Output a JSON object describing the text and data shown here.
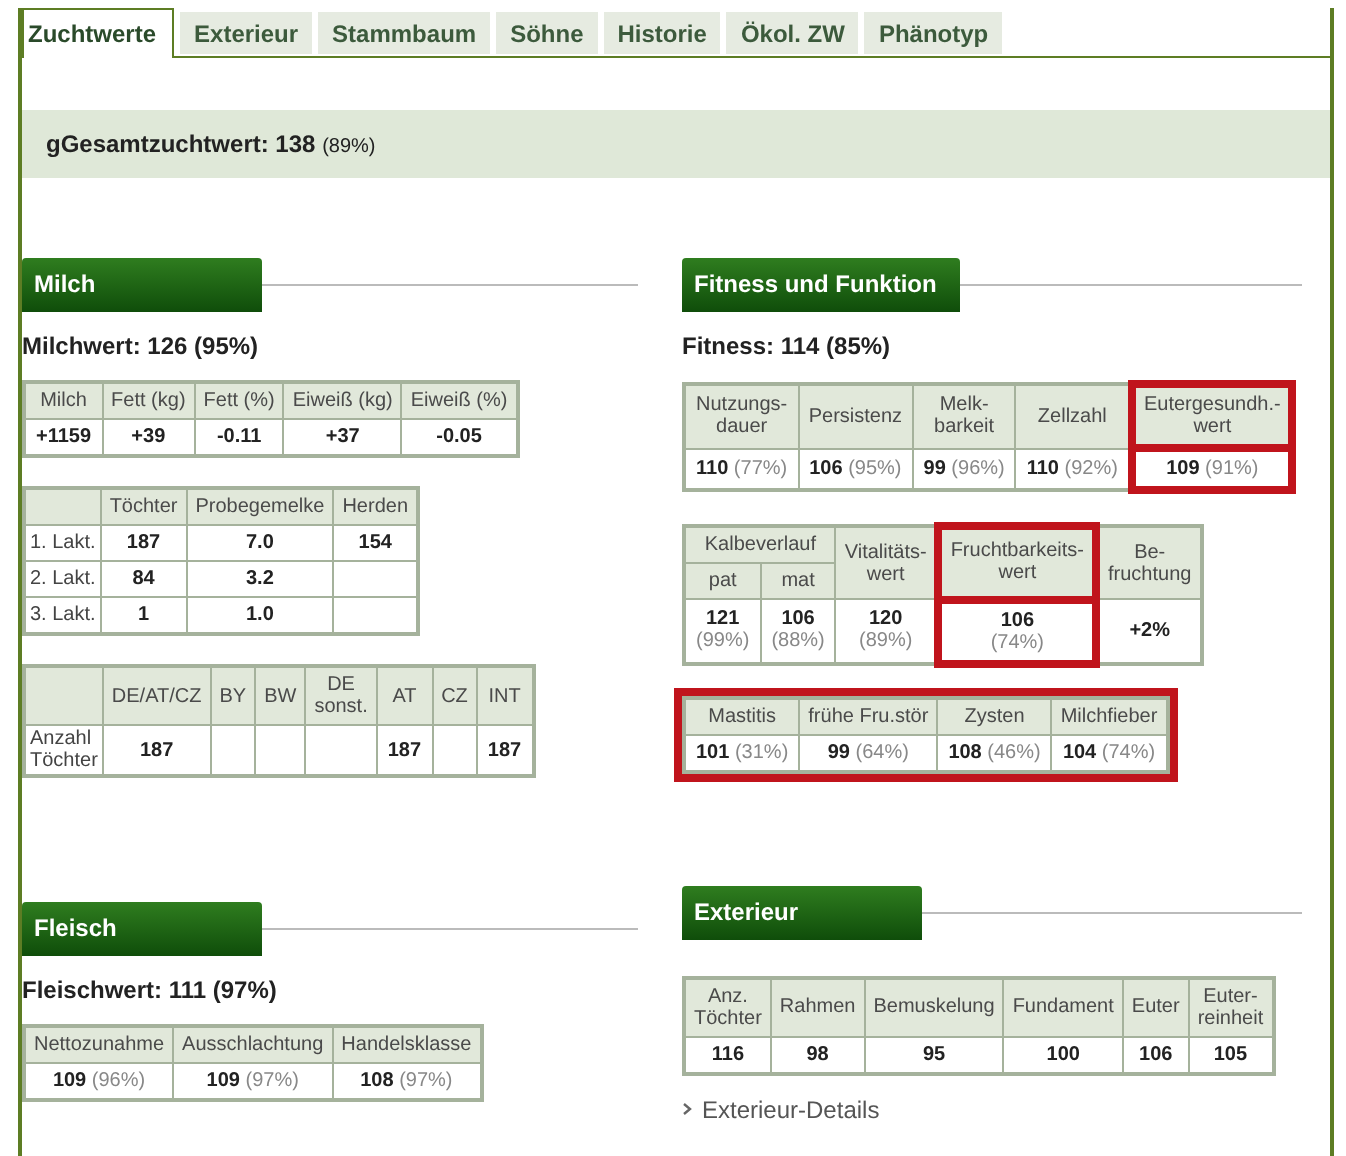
{
  "tabs": [
    {
      "label": "Zuchtwerte",
      "selected": true
    },
    {
      "label": "Exterieur",
      "selected": false
    },
    {
      "label": "Stammbaum",
      "selected": false
    },
    {
      "label": "Söhne",
      "selected": false
    },
    {
      "label": "Historie",
      "selected": false
    },
    {
      "label": "Ökol. ZW",
      "selected": false
    },
    {
      "label": "Phänotyp",
      "selected": false
    }
  ],
  "summary": {
    "label": "gGesamtzuchtwert: 138",
    "share": "(89%)"
  },
  "left_column": [
    {
      "title": "Milch",
      "score": "Milchwert: 126 (95%)",
      "tables": [
        {
          "highlighted": false,
          "rows": [
            [
              {
                "kind": "head",
                "text": "Milch"
              },
              {
                "kind": "head",
                "text": "Fett (kg)"
              },
              {
                "kind": "head",
                "text": "Fett (%)"
              },
              {
                "kind": "head",
                "text": "Eiweiß (kg)"
              },
              {
                "kind": "head",
                "text": "Eiweiß (%)"
              }
            ],
            [
              {
                "kind": "value",
                "text": "+1159"
              },
              {
                "kind": "value",
                "text": "+39"
              },
              {
                "kind": "value",
                "text": "-0.11"
              },
              {
                "kind": "value",
                "text": "+37"
              },
              {
                "kind": "value",
                "text": "-0.05"
              }
            ]
          ]
        },
        {
          "highlighted": false,
          "rows": [
            [
              {
                "kind": "blank"
              },
              {
                "kind": "head",
                "text": "Töchter"
              },
              {
                "kind": "head",
                "text": "Probegemelke"
              },
              {
                "kind": "head",
                "text": "Herden"
              }
            ],
            [
              {
                "kind": "label",
                "text": "1. Lakt."
              },
              {
                "kind": "value",
                "text": "187"
              },
              {
                "kind": "value",
                "text": "7.0"
              },
              {
                "kind": "value",
                "text": "154"
              }
            ],
            [
              {
                "kind": "label",
                "text": "2. Lakt."
              },
              {
                "kind": "value",
                "text": "84"
              },
              {
                "kind": "value",
                "text": "3.2"
              },
              {
                "kind": "blank"
              }
            ],
            [
              {
                "kind": "label",
                "text": "3. Lakt."
              },
              {
                "kind": "value",
                "text": "1"
              },
              {
                "kind": "value",
                "text": "1.0"
              },
              {
                "kind": "blank"
              }
            ]
          ]
        },
        {
          "highlighted": false,
          "rows": [
            [
              {
                "kind": "blank"
              },
              {
                "kind": "head",
                "text": "DE/AT/CZ"
              },
              {
                "kind": "head",
                "text": "BY"
              },
              {
                "kind": "head",
                "text": "BW"
              },
              {
                "kind": "head",
                "text": "DE\nsonst."
              },
              {
                "kind": "head",
                "text": "AT"
              },
              {
                "kind": "head",
                "text": "CZ"
              },
              {
                "kind": "head",
                "text": "INT"
              }
            ],
            [
              {
                "kind": "label",
                "text": "Anzahl\nTöchter"
              },
              {
                "kind": "value",
                "text": "187"
              },
              {
                "kind": "blank"
              },
              {
                "kind": "blank"
              },
              {
                "kind": "blank"
              },
              {
                "kind": "value",
                "text": "187"
              },
              {
                "kind": "blank"
              },
              {
                "kind": "value",
                "text": "187"
              }
            ]
          ]
        }
      ]
    },
    {
      "title": "Fleisch",
      "score": "Fleischwert: 111 (97%)",
      "tables": [
        {
          "stacked": false,
          "highlighted": false,
          "rows": [
            [
              {
                "kind": "head",
                "text": "Nettozunahme"
              },
              {
                "kind": "head",
                "text": "Ausschlachtung"
              },
              {
                "kind": "head",
                "text": "Handelsklasse"
              }
            ],
            [
              {
                "kind": "value",
                "text": "109",
                "share": "(96%)"
              },
              {
                "kind": "value",
                "text": "109",
                "share": "(97%)"
              },
              {
                "kind": "value",
                "text": "108",
                "share": "(97%)"
              }
            ]
          ]
        }
      ]
    }
  ],
  "right_column": [
    {
      "title": "Fitness und Funktion",
      "score": "Fitness: 114 (85%)",
      "tables": [
        {
          "stacked": false,
          "highlighted": false,
          "rows": [
            [
              {
                "kind": "head",
                "text": "Nutzungs-\ndauer",
                "highlighted": false
              },
              {
                "kind": "head",
                "text": "Persistenz",
                "highlighted": false
              },
              {
                "kind": "head",
                "text": "Melk-\nbarkeit",
                "highlighted": false
              },
              {
                "kind": "head",
                "text": "Zellzahl",
                "highlighted": false
              },
              {
                "kind": "head",
                "text": "Eutergesundh.-\nwert",
                "highlighted": true
              }
            ],
            [
              {
                "kind": "value",
                "text": "110",
                "share": "(77%)",
                "highlighted": false
              },
              {
                "kind": "value",
                "text": "106",
                "share": "(95%)",
                "highlighted": false
              },
              {
                "kind": "value",
                "text": "99",
                "share": "(96%)",
                "highlighted": false
              },
              {
                "kind": "value",
                "text": "110",
                "share": "(92%)",
                "highlighted": false
              },
              {
                "kind": "value",
                "text": "109",
                "share": "(91%)",
                "highlighted": true
              }
            ]
          ]
        },
        {
          "stacked": true,
          "highlighted": false,
          "rows": [
            [
              {
                "kind": "head",
                "text": "Kalbeverlauf",
                "colspan": 2,
                "highlighted": false
              },
              {
                "kind": "head",
                "text": "Vitalitäts-\nwert",
                "rowspan": 2,
                "highlighted": false
              },
              {
                "kind": "head",
                "text": "Fruchtbarkeits-\nwert",
                "rowspan": 2,
                "highlighted": true
              },
              {
                "kind": "head",
                "text": "Be-\nfruchtung",
                "rowspan": 2,
                "highlighted": false
              }
            ],
            [
              {
                "kind": "head",
                "text": "pat",
                "highlighted": false
              },
              {
                "kind": "head",
                "text": "mat",
                "highlighted": false
              }
            ],
            [
              {
                "kind": "value",
                "text": "121",
                "share": "(99%)",
                "highlighted": false
              },
              {
                "kind": "value",
                "text": "106",
                "share": "(88%)",
                "highlighted": false
              },
              {
                "kind": "value",
                "text": "120",
                "share": "(89%)",
                "highlighted": false
              },
              {
                "kind": "value",
                "text": "106",
                "share": "(74%)",
                "highlighted": true
              },
              {
                "kind": "value",
                "text": "+2%",
                "highlighted": false
              }
            ]
          ]
        },
        {
          "stacked": false,
          "highlighted": true,
          "rows": [
            [
              {
                "kind": "head",
                "text": "Mastitis"
              },
              {
                "kind": "head",
                "text": "frühe Fru.stör"
              },
              {
                "kind": "head",
                "text": "Zysten"
              },
              {
                "kind": "head",
                "text": "Milchfieber"
              }
            ],
            [
              {
                "kind": "value",
                "text": "101",
                "share": "(31%)"
              },
              {
                "kind": "value",
                "text": "99",
                "share": "(64%)"
              },
              {
                "kind": "value",
                "text": "108",
                "share": "(46%)"
              },
              {
                "kind": "value",
                "text": "104",
                "share": "(74%)"
              }
            ]
          ]
        }
      ]
    },
    {
      "title": "Exterieur",
      "tables": [
        {
          "highlighted": false,
          "rows": [
            [
              {
                "kind": "head",
                "text": "Anz.\nTöchter"
              },
              {
                "kind": "head",
                "text": "Rahmen"
              },
              {
                "kind": "head",
                "text": "Bemuskelung"
              },
              {
                "kind": "head",
                "text": "Fundament"
              },
              {
                "kind": "head",
                "text": "Euter"
              },
              {
                "kind": "head",
                "text": "Euter-\nreinheit"
              }
            ],
            [
              {
                "kind": "value",
                "text": "116"
              },
              {
                "kind": "value",
                "text": "98"
              },
              {
                "kind": "value",
                "text": "95"
              },
              {
                "kind": "value",
                "text": "100"
              },
              {
                "kind": "value",
                "text": "106"
              },
              {
                "kind": "value",
                "text": "105"
              }
            ]
          ]
        }
      ],
      "link": "Exterieur-Details"
    }
  ]
}
